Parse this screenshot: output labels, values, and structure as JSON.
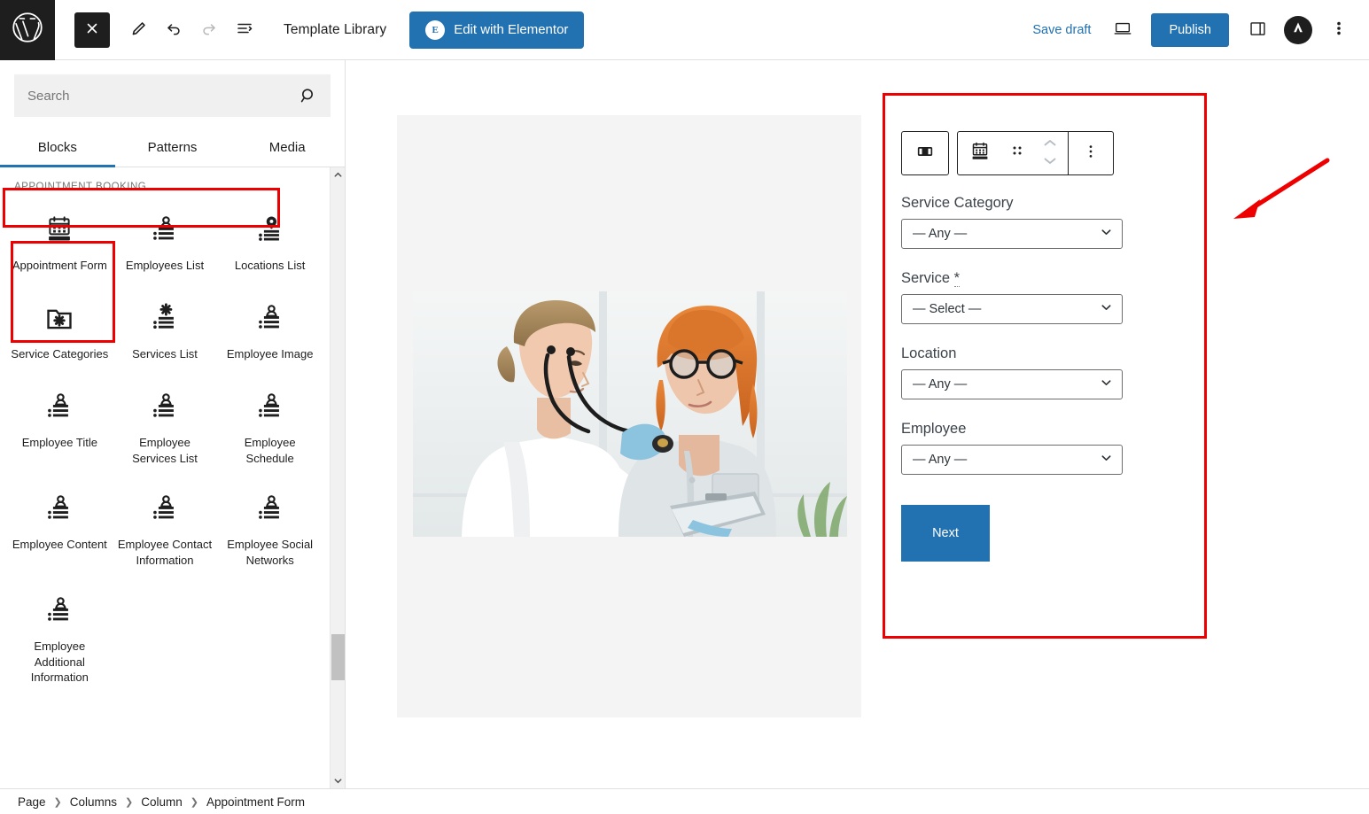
{
  "topbar": {
    "logo_icon": "wordpress-logo-icon",
    "close_icon": "close-icon",
    "edit_icon": "pencil-edit-icon",
    "undo_icon": "undo-arrow-icon",
    "redo_icon": "redo-arrow-icon",
    "list_view_icon": "list-view-icon",
    "template_library": "Template Library",
    "elementor_button": "Edit with Elementor",
    "elementor_badge": "E",
    "save_draft": "Save draft",
    "preview_icon": "desktop-preview-icon",
    "publish": "Publish",
    "settings_icon": "sidebar-panel-icon",
    "avatar_icon": "astra-avatar-icon",
    "more_icon": "more-options-icon"
  },
  "sidebar": {
    "search": {
      "value": "",
      "placeholder": "Search",
      "icon": "search-icon"
    },
    "tabs": [
      {
        "label": "Blocks",
        "active": true
      },
      {
        "label": "Patterns",
        "active": false
      },
      {
        "label": "Media",
        "active": false
      }
    ],
    "section_label": "APPOINTMENT BOOKING",
    "blocks": [
      {
        "label": "Appointment Form",
        "icon": "calendar-form-icon",
        "selected": true
      },
      {
        "label": "Employees List",
        "icon": "person-list-icon",
        "selected": false
      },
      {
        "label": "Locations List",
        "icon": "location-pin-list-icon",
        "selected": false
      },
      {
        "label": "Service Categories",
        "icon": "folder-gear-icon",
        "selected": false
      },
      {
        "label": "Services List",
        "icon": "gear-list-icon",
        "selected": false
      },
      {
        "label": "Employee Image",
        "icon": "person-list-icon",
        "selected": false
      },
      {
        "label": "Employee Title",
        "icon": "person-list-icon",
        "selected": false
      },
      {
        "label": "Employee Services List",
        "icon": "person-list-icon",
        "selected": false
      },
      {
        "label": "Employee Schedule",
        "icon": "person-list-icon",
        "selected": false
      },
      {
        "label": "Employee Content",
        "icon": "person-list-icon",
        "selected": false
      },
      {
        "label": "Employee Contact Information",
        "icon": "person-list-icon",
        "selected": false
      },
      {
        "label": "Employee Social Networks",
        "icon": "person-list-icon",
        "selected": false
      },
      {
        "label": "Employee Additional Information",
        "icon": "person-list-icon",
        "selected": false
      }
    ],
    "scroll_up_icon": "chevron-up-icon",
    "scroll_down_icon": "chevron-down-icon"
  },
  "canvas": {
    "block_toolbar": {
      "columns_icon": "columns-layout-icon",
      "block_type_icon": "appointment-form-block-icon",
      "drag_icon": "drag-handle-icon",
      "move_up_icon": "chevron-up-icon",
      "move_down_icon": "chevron-down-icon",
      "options_icon": "more-options-icon"
    },
    "image_alt": "doctor-examining-patient-photo",
    "form": {
      "fields": [
        {
          "label": "Service Category",
          "required": false,
          "value": "— Any —"
        },
        {
          "label": "Service",
          "required": true,
          "required_marker": "*",
          "value": "— Select —"
        },
        {
          "label": "Location",
          "required": false,
          "value": "— Any —"
        },
        {
          "label": "Employee",
          "required": false,
          "value": "— Any —"
        }
      ],
      "submit_label": "Next"
    }
  },
  "annotations": {
    "highlight_color": "#ee0000",
    "arrow_icon": "red-pointer-arrow-icon"
  },
  "breadcrumb": {
    "items": [
      "Page",
      "Columns",
      "Column",
      "Appointment Form"
    ],
    "separator": "❯"
  },
  "colors": {
    "accent": "#2271b1",
    "dark": "#1e1e1e",
    "panel_bg": "#f4f4f4",
    "highlight": "#ee0000"
  }
}
